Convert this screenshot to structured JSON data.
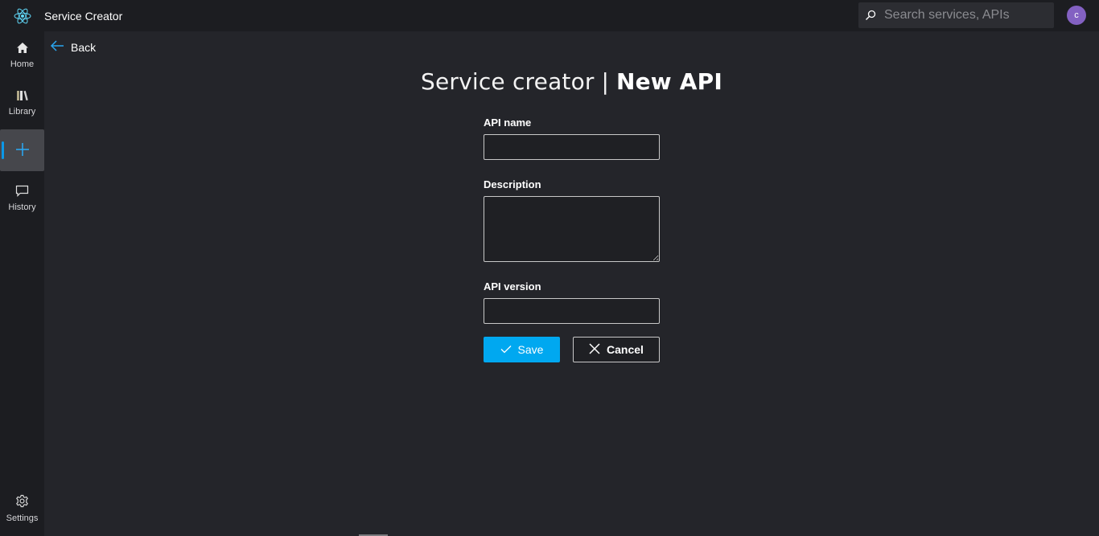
{
  "app": {
    "title": "Service Creator"
  },
  "search": {
    "placeholder": "Search services, APIs"
  },
  "user": {
    "avatar_initial": "c",
    "avatar_color": "#8361c2"
  },
  "sidebar": {
    "items": [
      {
        "label": "Home",
        "icon": "home-icon"
      },
      {
        "label": "Library",
        "icon": "library-icon"
      },
      {
        "label": "",
        "icon": "add-icon",
        "active": true
      },
      {
        "label": "History",
        "icon": "chat-bubble-icon"
      }
    ],
    "settings_label": "Settings"
  },
  "back": {
    "label": "Back"
  },
  "page": {
    "title_prefix": "Service creator",
    "title_separator": "|",
    "title_main": "New API"
  },
  "form": {
    "api_name": {
      "label": "API name",
      "value": ""
    },
    "description": {
      "label": "Description",
      "value": ""
    },
    "api_version": {
      "label": "API version",
      "value": ""
    }
  },
  "buttons": {
    "save_label": "Save",
    "cancel_label": "Cancel"
  },
  "colors": {
    "accent": "#00a8f0",
    "nav_indicator": "#0b98e8",
    "background": "#24252a",
    "chrome": "#1c1d21"
  }
}
